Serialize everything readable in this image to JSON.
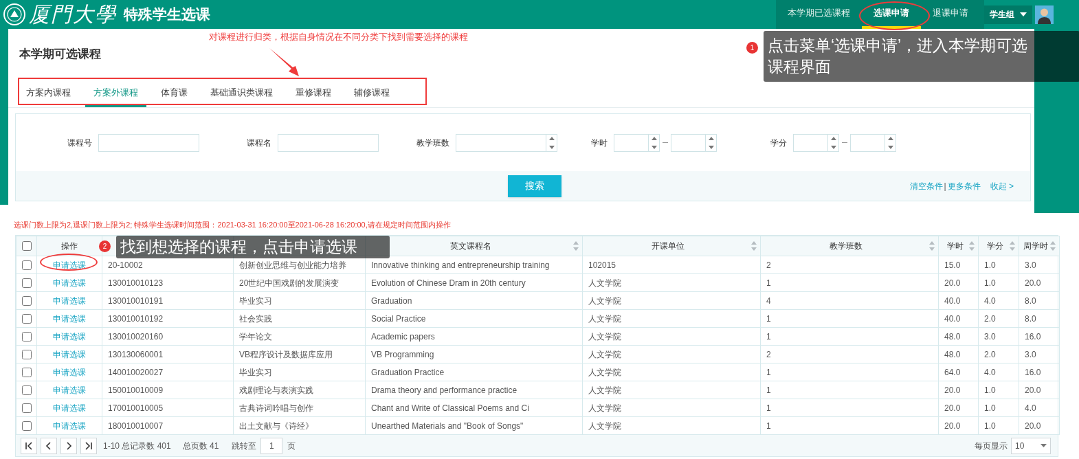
{
  "header": {
    "school_name": "厦門大學",
    "system_title": "特殊学生选课",
    "nav": [
      {
        "label": "本学期已选课程",
        "selected": false
      },
      {
        "label": "选课申请",
        "selected": true
      },
      {
        "label": "退课申请",
        "selected": false
      }
    ],
    "user_group": "学生组"
  },
  "category_note": "对课程进行归类，根据自身情况在不同分类下找到需要选择的课程",
  "page_title": "本学期可选课程",
  "tabs": [
    {
      "label": "方案内课程",
      "selected": false
    },
    {
      "label": "方案外课程",
      "selected": true
    },
    {
      "label": "体育课",
      "selected": false
    },
    {
      "label": "基础通识类课程",
      "selected": false
    },
    {
      "label": "重修课程",
      "selected": false
    },
    {
      "label": "辅修课程",
      "selected": false
    }
  ],
  "search": {
    "fields": [
      {
        "label": "课程号",
        "kind": "text"
      },
      {
        "label": "课程名",
        "kind": "text"
      },
      {
        "label": "教学班数",
        "kind": "number"
      },
      {
        "label": "学时",
        "kind": "range"
      },
      {
        "label": "学分",
        "kind": "range"
      }
    ],
    "button": "搜索",
    "links": [
      "清空条件",
      "更多条件"
    ],
    "separator": "|",
    "collapse": "收起 >"
  },
  "notice": "选课门数上限为2,退课门数上限为2;  特殊学生选课时间范围：2021-03-31 16:20:00至2021-06-28 16:20:00,请在规定时间范围内操作",
  "table": {
    "all_checked": false,
    "columns": [
      {
        "label": "操作",
        "sortable": false
      },
      {
        "sortable": false
      },
      {
        "sortable": false
      },
      {
        "label": "英文课程名",
        "sortable": true
      },
      {
        "label": "开课单位",
        "sortable": true
      },
      {
        "label": "教学班数",
        "sortable": true
      },
      {
        "label": "学时",
        "sortable": true
      },
      {
        "label": "学分",
        "sortable": true
      },
      {
        "label": "周学时",
        "sortable": true
      }
    ],
    "rows": [
      {
        "checked": false,
        "cells": [
          "申请选课",
          "20-10002",
          "创新创业思维与创业能力培养",
          "Innovative thinking and entrepreneurship training",
          "102015",
          "2",
          "15.0",
          "1.0",
          "3.0"
        ]
      },
      {
        "checked": false,
        "cells": [
          "申请选课",
          "130010010123",
          "20世纪中国戏剧的发展演变",
          "Evolution of Chinese Dram in 20th century",
          "人文学院",
          "1",
          "20.0",
          "1.0",
          "20.0"
        ]
      },
      {
        "checked": false,
        "cells": [
          "申请选课",
          "130010010191",
          "毕业实习",
          "Graduation",
          "人文学院",
          "4",
          "40.0",
          "4.0",
          "8.0"
        ]
      },
      {
        "checked": false,
        "cells": [
          "申请选课",
          "130010010192",
          "社会实践",
          "Social Practice",
          "人文学院",
          "1",
          "40.0",
          "2.0",
          "8.0"
        ]
      },
      {
        "checked": false,
        "cells": [
          "申请选课",
          "130010020160",
          "学年论文",
          "Academic papers",
          "人文学院",
          "1",
          "48.0",
          "3.0",
          "16.0"
        ]
      },
      {
        "checked": false,
        "cells": [
          "申请选课",
          "130130060001",
          "VB程序设计及数据库应用",
          "VB Programming",
          "人文学院",
          "2",
          "48.0",
          "2.0",
          "3.0"
        ]
      },
      {
        "checked": false,
        "cells": [
          "申请选课",
          "140010020027",
          "毕业实习",
          "Graduation Practice",
          "人文学院",
          "1",
          "64.0",
          "4.0",
          "16.0"
        ]
      },
      {
        "checked": false,
        "cells": [
          "申请选课",
          "150010010009",
          "戏剧理论与表演实践",
          "Drama theory and performance practice",
          "人文学院",
          "1",
          "20.0",
          "1.0",
          "20.0"
        ]
      },
      {
        "checked": false,
        "cells": [
          "申请选课",
          "170010010005",
          "古典诗词吟唱与创作",
          "Chant and Write of Classical Poems and Ci",
          "人文学院",
          "1",
          "20.0",
          "1.0",
          "4.0"
        ]
      },
      {
        "checked": false,
        "cells": [
          "申请选课",
          "180010010007",
          "出土文献与《诗经》",
          "Unearthed Materials and \"Book of Songs\"",
          "人文学院",
          "1",
          "20.0",
          "1.0",
          "20.0"
        ]
      }
    ]
  },
  "pagination": {
    "summary": "1-10 总记录数 401",
    "pages": "总页数 41",
    "jump_label": "跳转至",
    "page": "1",
    "page_unit": "页",
    "page_size_label": "每页显示",
    "page_size": "10"
  },
  "annotations": [
    {
      "number": "1",
      "text": "点击菜单‘选课申请’，进入本学期可选课程界面"
    },
    {
      "number": "2",
      "text": "找到想选择的课程，点击申请选课"
    }
  ]
}
